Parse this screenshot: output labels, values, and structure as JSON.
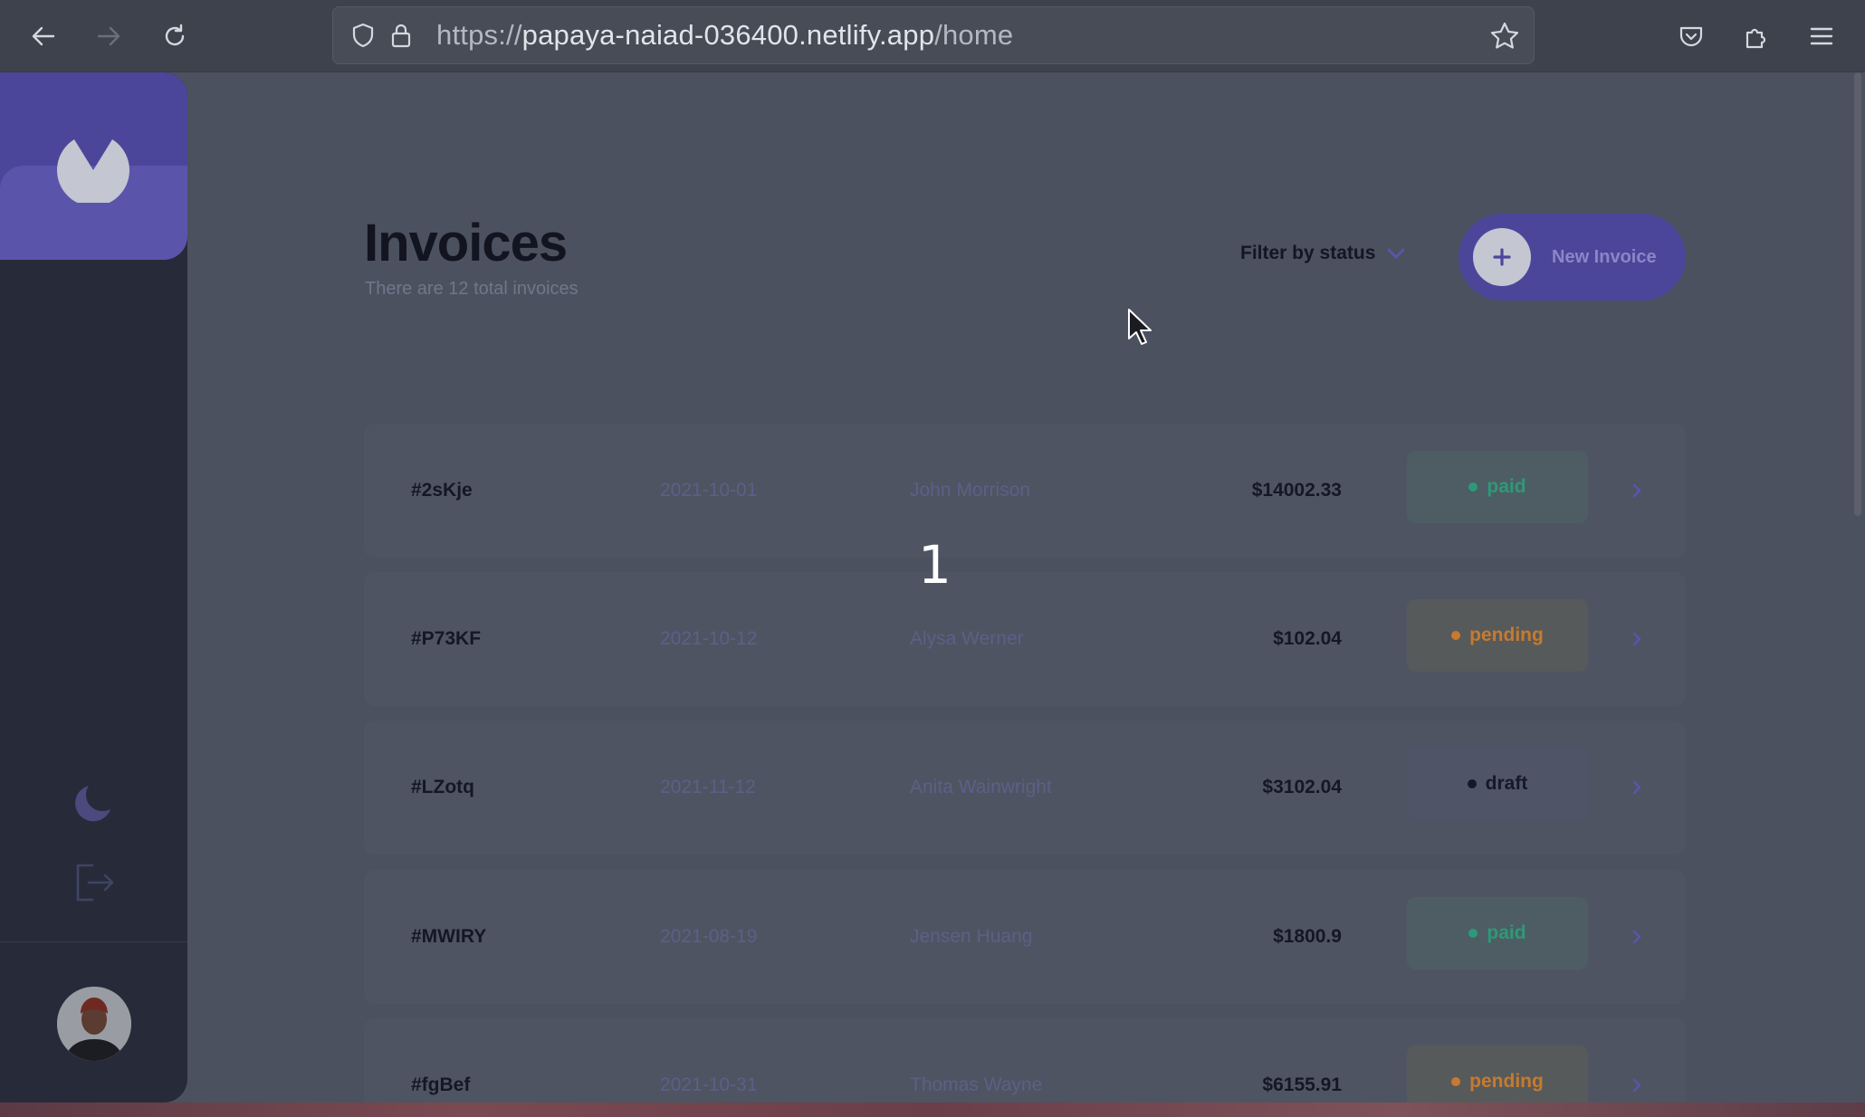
{
  "browser": {
    "url_scheme": "https://",
    "url_host": "papaya-naiad-036400.netlify.app",
    "url_path": "/home"
  },
  "page": {
    "title": "Invoices",
    "subtitle": "There are 12 total invoices",
    "filter_label": "Filter by status",
    "new_button_label": "New Invoice"
  },
  "invoices": [
    {
      "id": "#2sKje",
      "date": "2021-10-01",
      "name": "John Morrison",
      "amount": "$14002.33",
      "status": "paid"
    },
    {
      "id": "#P73KF",
      "date": "2021-10-12",
      "name": "Alysa Werner",
      "amount": "$102.04",
      "status": "pending"
    },
    {
      "id": "#LZotq",
      "date": "2021-11-12",
      "name": "Anita Wainwright",
      "amount": "$3102.04",
      "status": "draft"
    },
    {
      "id": "#MWIRY",
      "date": "2021-08-19",
      "name": "Jensen Huang",
      "amount": "$1800.9",
      "status": "paid"
    },
    {
      "id": "#fgBef",
      "date": "2021-10-31",
      "name": "Thomas Wayne",
      "amount": "$6155.91",
      "status": "pending"
    }
  ],
  "overlay": {
    "step_number": "1"
  },
  "colors": {
    "accent": "#7c5dfa",
    "paid": "#33d69f",
    "pending": "#ff8f00",
    "draft": "#373b53"
  }
}
